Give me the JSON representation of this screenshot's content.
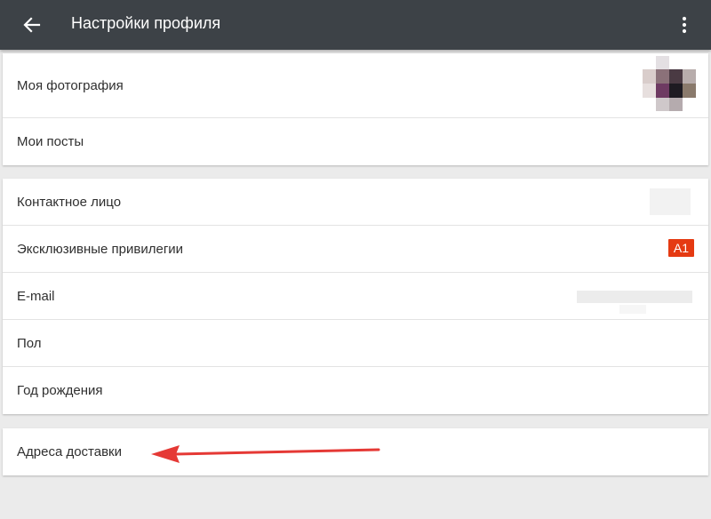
{
  "header": {
    "title": "Настройки профиля",
    "back_icon": "arrow-left-icon",
    "menu_icon": "more-vert-icon",
    "background": "#3d4247"
  },
  "section1": {
    "photo_label": "Моя фотография",
    "posts_label": "Мои посты"
  },
  "section2": {
    "contact_label": "Контактное лицо",
    "privileges_label": "Эксклюзивные привилегии",
    "privileges_badge": "A1",
    "email_label": "E-mail",
    "gender_label": "Пол",
    "birth_year_label": "Год рождения"
  },
  "section3": {
    "address_label": "Адреса доставки"
  },
  "colors": {
    "badge": "#e53a12",
    "annotation_arrow": "#e53935"
  }
}
